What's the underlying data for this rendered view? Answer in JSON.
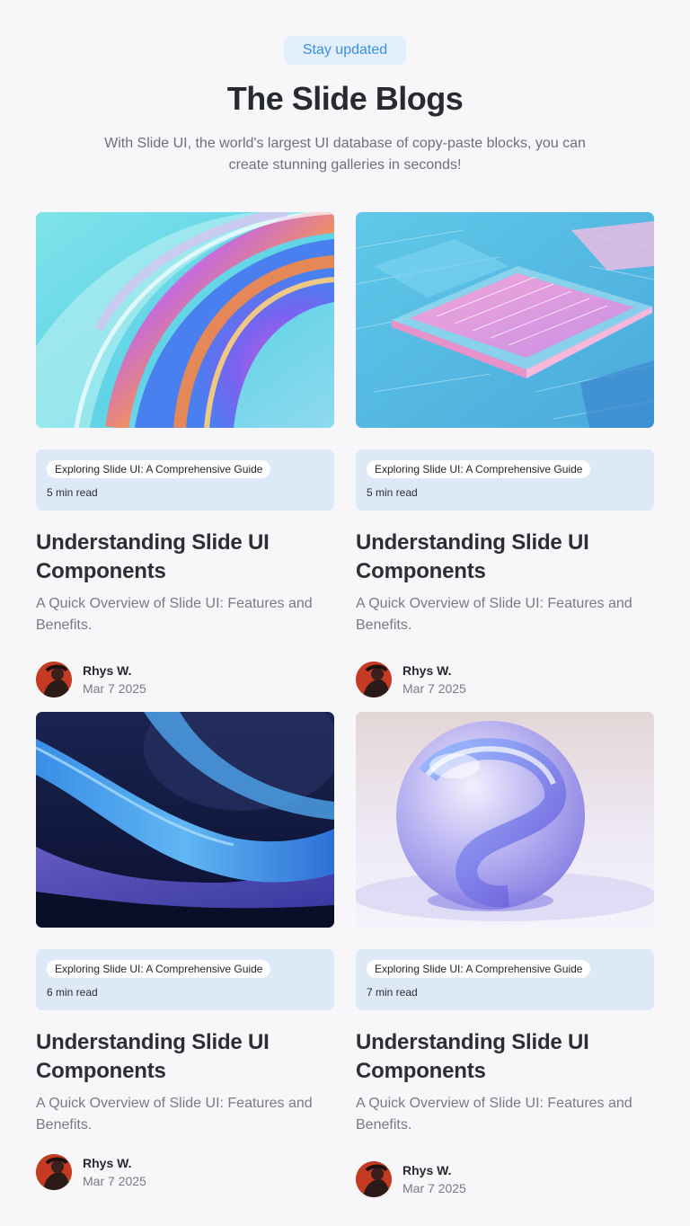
{
  "header": {
    "badge": "Stay updated",
    "title": "The Slide Blogs",
    "subtitle": "With Slide UI, the world's largest UI database of copy-paste blocks, you can create stunning galleries in seconds!"
  },
  "posts": [
    {
      "image": "abstract-glass-swirl-image",
      "tag": "Exploring Slide UI: A Comprehensive Guide",
      "read_time": "5 min read",
      "title": "Understanding Slide UI Components",
      "description": "A Quick Overview of Slide UI: Features and Benefits.",
      "author": "Rhys W.",
      "date": "Mar 7 2025"
    },
    {
      "image": "circuit-chip-image",
      "tag": "Exploring Slide UI: A Comprehensive Guide",
      "read_time": "5 min read",
      "title": "Understanding Slide UI Components",
      "description": "A Quick Overview of Slide UI: Features and Benefits.",
      "author": "Rhys W.",
      "date": "Mar 7 2025"
    },
    {
      "image": "blue-waves-image",
      "tag": "Exploring Slide UI: A Comprehensive Guide",
      "read_time": "6 min read",
      "title": "Understanding Slide UI Components",
      "description": "A Quick Overview of Slide UI: Features and Benefits.",
      "author": "Rhys W.",
      "date": "Mar 7 2025"
    },
    {
      "image": "glass-sphere-image",
      "tag": "Exploring Slide UI: A Comprehensive Guide",
      "read_time": "7 min read",
      "title": "Understanding Slide UI Components",
      "description": "A Quick Overview of Slide UI: Features and Benefits.",
      "author": "Rhys W.",
      "date": "Mar 7 2025"
    }
  ]
}
